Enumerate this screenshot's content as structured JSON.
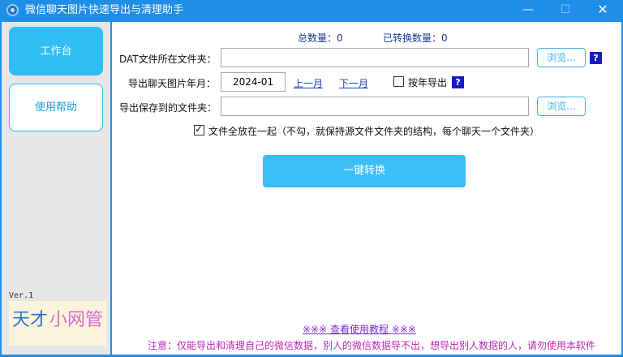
{
  "window": {
    "title": "微信聊天图片快速导出与清理助手",
    "minimize_glyph": "—",
    "maximize_glyph": "☐",
    "close_glyph": "✕"
  },
  "sidebar": {
    "items": [
      {
        "label": "工作台",
        "active": true
      },
      {
        "label": "使用帮助",
        "active": false
      }
    ],
    "version": "Ver.1",
    "logo_part1": "天才",
    "logo_part2": "小网管"
  },
  "stats": {
    "total_label": "总数量：0",
    "converted_label": "已转换数量：0"
  },
  "form": {
    "dat_folder_label": "DAT文件所在文件夹：",
    "dat_folder_value": "",
    "browse_label": "浏览...",
    "help_glyph": "?",
    "month_label": "导出聊天图片年月：",
    "month_value": "2024-01",
    "prev_month": "上一月",
    "next_month": "下一月",
    "by_year_label": "按年导出",
    "by_year_checked": false,
    "save_folder_label": "导出保存到的文件夹：",
    "save_folder_value": "",
    "flatten_label": "文件全放在一起（不勾，就保持源文件文件夹的结构，每个聊天一个文件夹）",
    "flatten_checked": true,
    "convert_button": "一键转换"
  },
  "footer": {
    "tutorial_link": "※※※  查看使用教程  ※※※",
    "notice": "注意：仅能导出和清理自己的微信数据，别人的微信数据导不出，想导出别人数据的人，请勿使用本软件"
  },
  "colors": {
    "titlebar": "#1f8ee8",
    "accent": "#2fbdf3",
    "notice": "#c028b8",
    "link": "#1a3fbf"
  }
}
